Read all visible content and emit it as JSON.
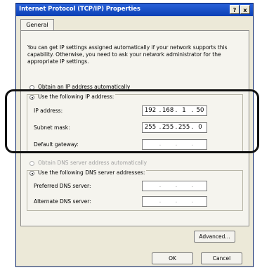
{
  "window": {
    "title": "Internet Protocol (TCP/IP) Properties",
    "help_button": "?",
    "close_button": "x"
  },
  "tabs": [
    {
      "label": "General"
    }
  ],
  "description": "You can get IP settings assigned automatically if your network supports this capability. Otherwise, you need to ask your network administrator for the appropriate IP settings.",
  "ip_options": {
    "auto_label": "Obtain an IP address automatically",
    "manual_label": "Use the following IP address:",
    "selected": "manual"
  },
  "ip_fields": [
    {
      "label": "IP address:",
      "octets": [
        "192",
        "168",
        "1",
        "50"
      ]
    },
    {
      "label": "Subnet mask:",
      "octets": [
        "255",
        "255",
        "255",
        "0"
      ]
    },
    {
      "label": "Default gateway:",
      "octets": [
        "",
        "",
        "",
        ""
      ]
    }
  ],
  "dns_options": {
    "auto_label": "Obtain DNS server address automatically",
    "manual_label": "Use the following DNS server addresses:",
    "selected": "manual"
  },
  "dns_fields": [
    {
      "label": "Preferred DNS server:",
      "octets": [
        "",
        "",
        "",
        ""
      ]
    },
    {
      "label": "Alternate DNS server:",
      "octets": [
        "",
        "",
        "",
        ""
      ]
    }
  ],
  "buttons": {
    "advanced": "Advanced...",
    "ok": "OK",
    "cancel": "Cancel"
  }
}
